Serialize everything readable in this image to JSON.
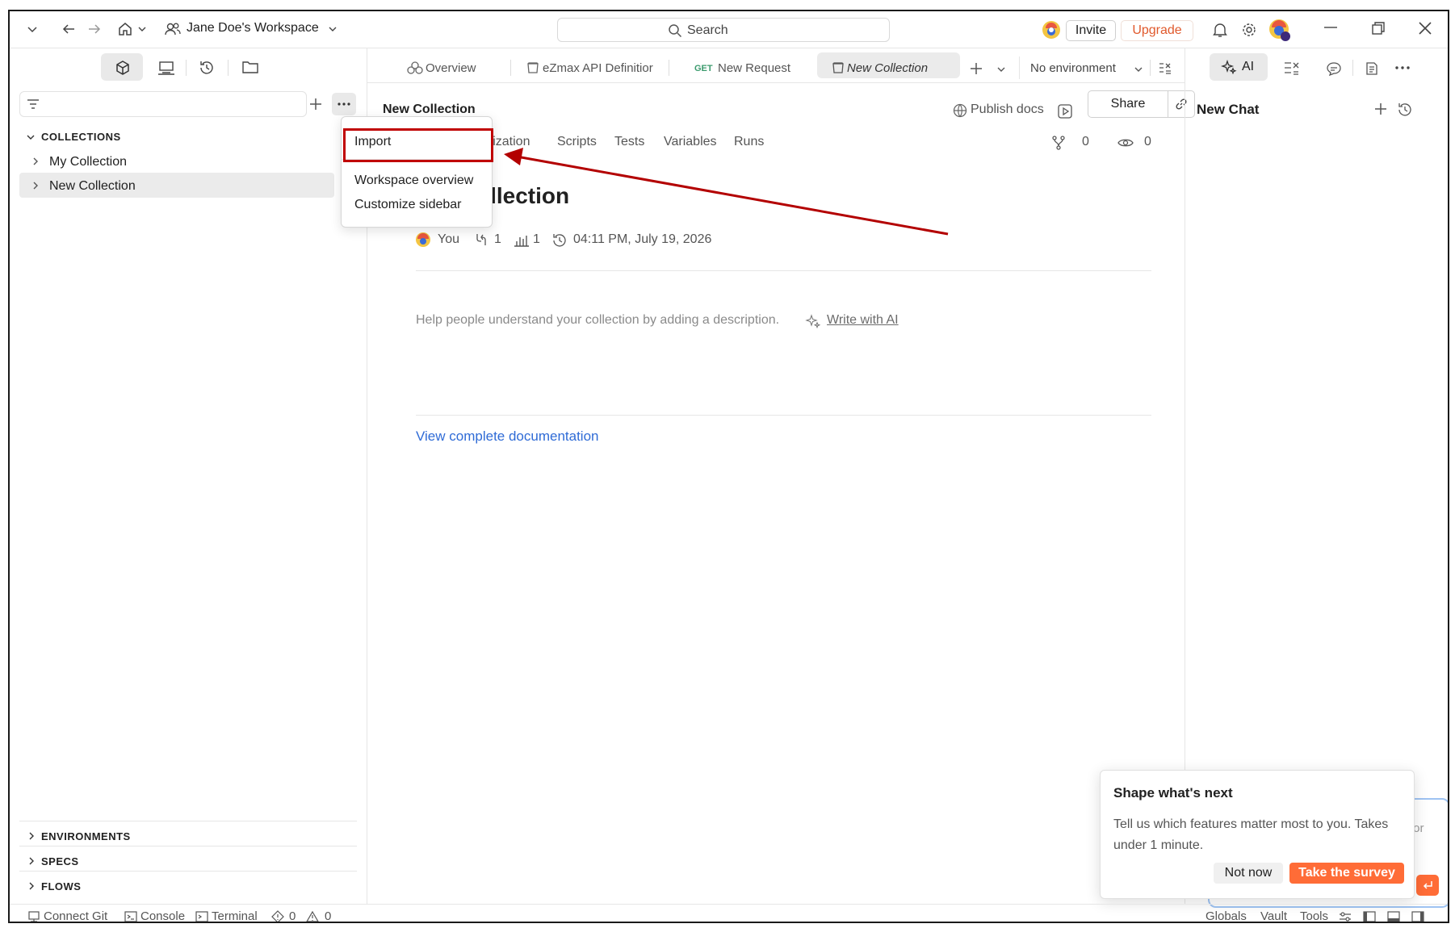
{
  "topbar": {
    "workspace_name": "Jane Doe's Workspace",
    "search_placeholder": "Search",
    "invite_label": "Invite",
    "upgrade_label": "Upgrade"
  },
  "sidebar": {
    "collections_title": "COLLECTIONS",
    "items": [
      {
        "label": "My Collection"
      },
      {
        "label": "New Collection"
      }
    ],
    "bottom_sections": [
      {
        "label": "ENVIRONMENTS"
      },
      {
        "label": "SPECS"
      },
      {
        "label": "FLOWS"
      }
    ]
  },
  "menu": {
    "items": [
      {
        "label": "Import"
      },
      {
        "label": "Workspace overview"
      },
      {
        "label": "Customize sidebar"
      }
    ]
  },
  "tabs": {
    "items": [
      {
        "label": "Overview"
      },
      {
        "label": "eZmax API Definitior"
      },
      {
        "method": "GET",
        "label": "New Request"
      },
      {
        "label": "New Collection"
      }
    ],
    "environment": "No environment"
  },
  "content": {
    "collection_name": "New Collection",
    "publish_label": "Publish docs",
    "share_label": "Share",
    "subtabs": [
      "orization",
      "Scripts",
      "Tests",
      "Variables",
      "Runs"
    ],
    "fork_count": "0",
    "watch_count": "0",
    "big_title_visible": "ollection",
    "meta": {
      "author": "You",
      "forks": "1",
      "requests": "1",
      "timestamp": "04:11 PM, July 19, 2026"
    },
    "description_placeholder": "Help people understand your collection by adding a description.",
    "write_ai_label": "Write with AI",
    "docs_link": "View complete documentation"
  },
  "right_panel": {
    "ai_label": "AI",
    "chat_title": "New Chat",
    "input_hint_fragment": "for"
  },
  "survey": {
    "title": "Shape what's next",
    "description": "Tell us which features matter most to you. Takes under 1 minute.",
    "not_now_label": "Not now",
    "take_label": "Take the survey"
  },
  "statusbar": {
    "connect_git": "Connect Git",
    "console": "Console",
    "terminal": "Terminal",
    "errors": "0",
    "warnings": "0",
    "globals": "Globals",
    "vault": "Vault",
    "tools": "Tools"
  },
  "colors": {
    "accent": "#ff6c37",
    "highlight_box": "#c00000",
    "link": "#2f6bd6"
  }
}
